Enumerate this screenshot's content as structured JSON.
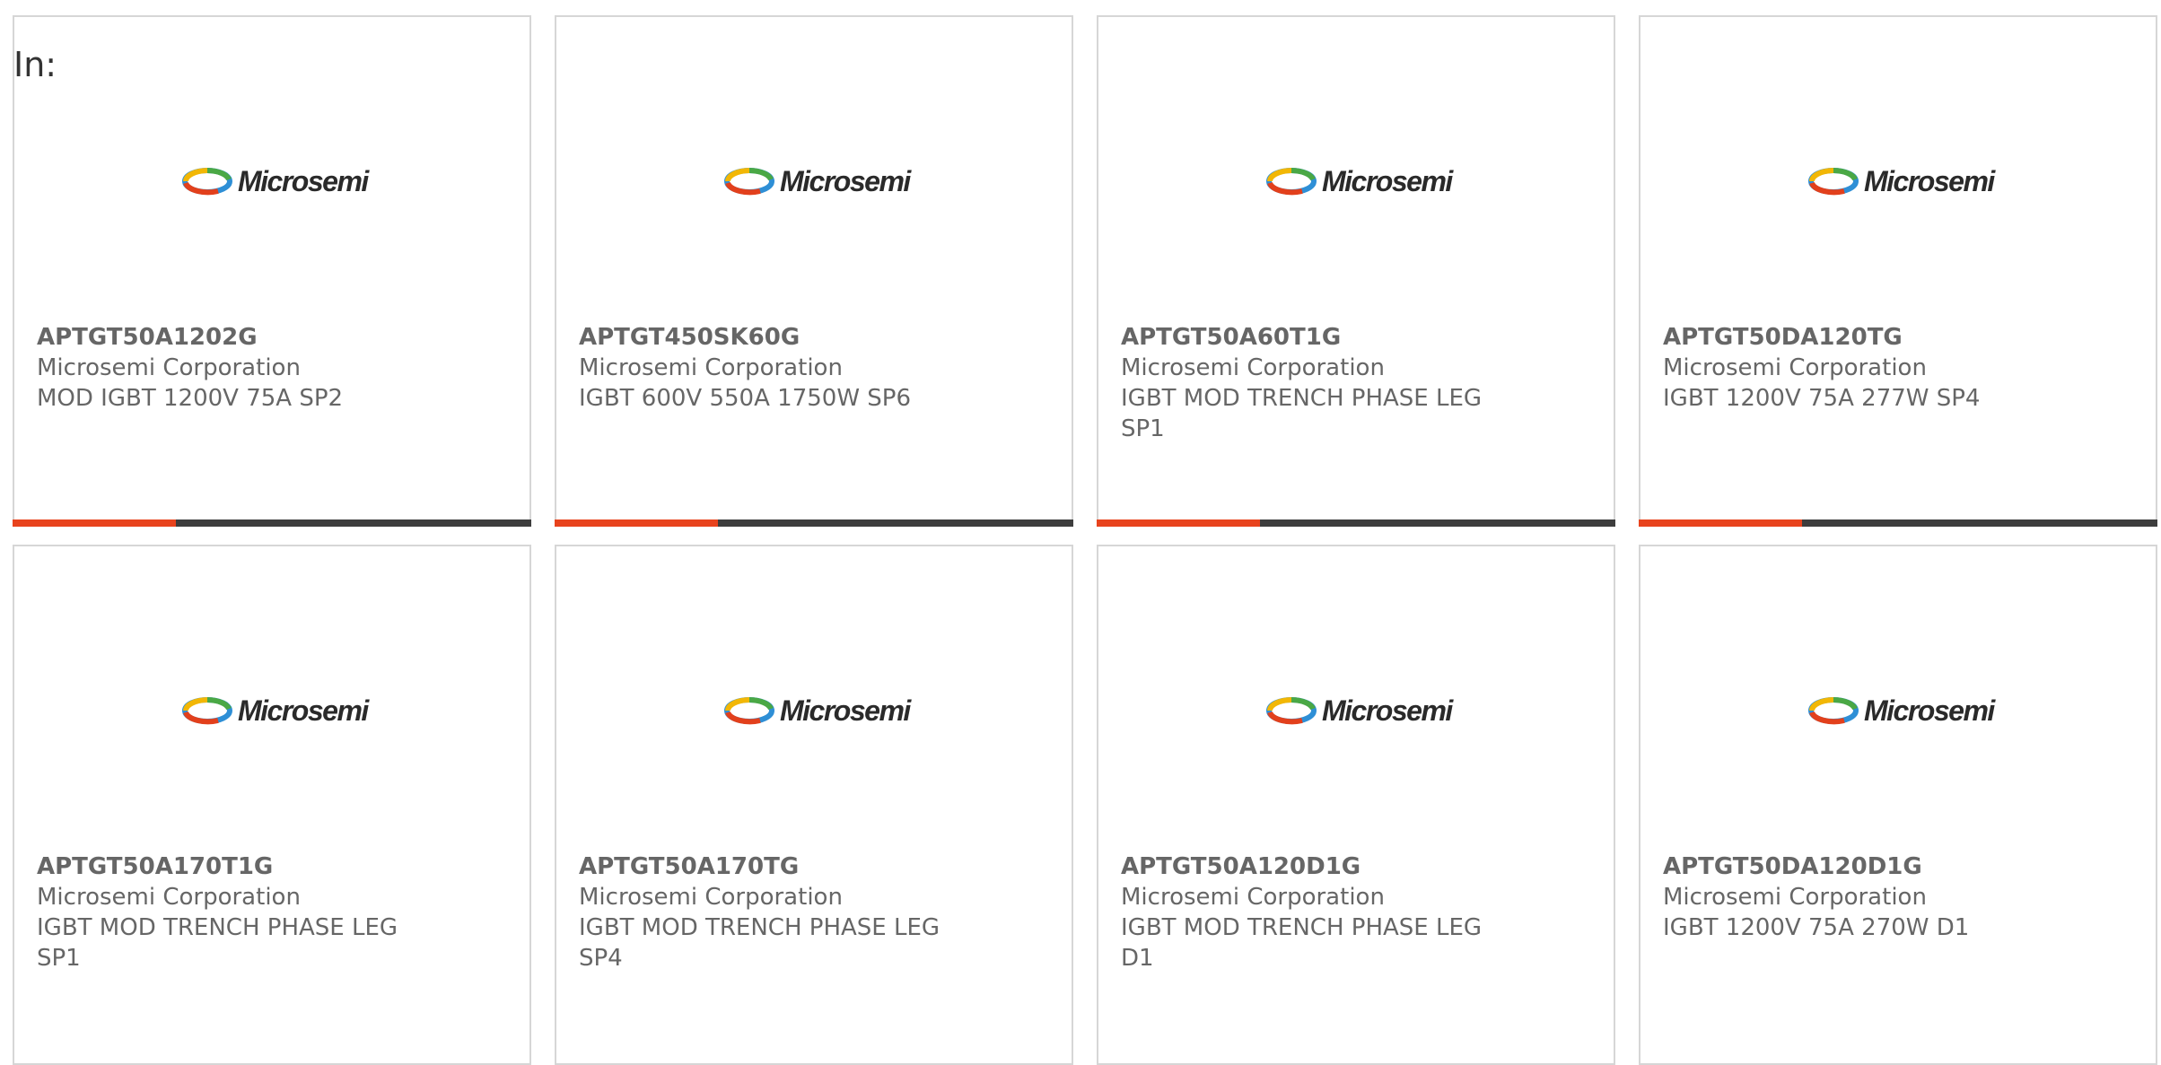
{
  "heading": "In:",
  "colors": {
    "accent": "#e8431d",
    "bar": "#3d3d3d",
    "text": "#666666",
    "border": "#d6d6d6"
  },
  "logo": {
    "text": "Microsemi",
    "icon": "microsemi-logo-icon"
  },
  "products": [
    {
      "part": "APTGT50A1202G",
      "manufacturer": "Microsemi Corporation",
      "description": "MOD IGBT 1200V 75A SP2"
    },
    {
      "part": "APTGT450SK60G",
      "manufacturer": "Microsemi Corporation",
      "description": "IGBT 600V 550A 1750W SP6"
    },
    {
      "part": "APTGT50A60T1G",
      "manufacturer": "Microsemi Corporation",
      "description": "IGBT MOD TRENCH PHASE LEG SP1"
    },
    {
      "part": "APTGT50DA120TG",
      "manufacturer": "Microsemi Corporation",
      "description": "IGBT 1200V 75A 277W SP4"
    },
    {
      "part": "APTGT50A170T1G",
      "manufacturer": "Microsemi Corporation",
      "description": "IGBT MOD TRENCH PHASE LEG SP1"
    },
    {
      "part": "APTGT50A170TG",
      "manufacturer": "Microsemi Corporation",
      "description": "IGBT MOD TRENCH PHASE LEG SP4"
    },
    {
      "part": "APTGT50A120D1G",
      "manufacturer": "Microsemi Corporation",
      "description": "IGBT MOD TRENCH PHASE LEG D1"
    },
    {
      "part": "APTGT50DA120D1G",
      "manufacturer": "Microsemi Corporation",
      "description": "IGBT 1200V 75A 270W D1"
    }
  ]
}
